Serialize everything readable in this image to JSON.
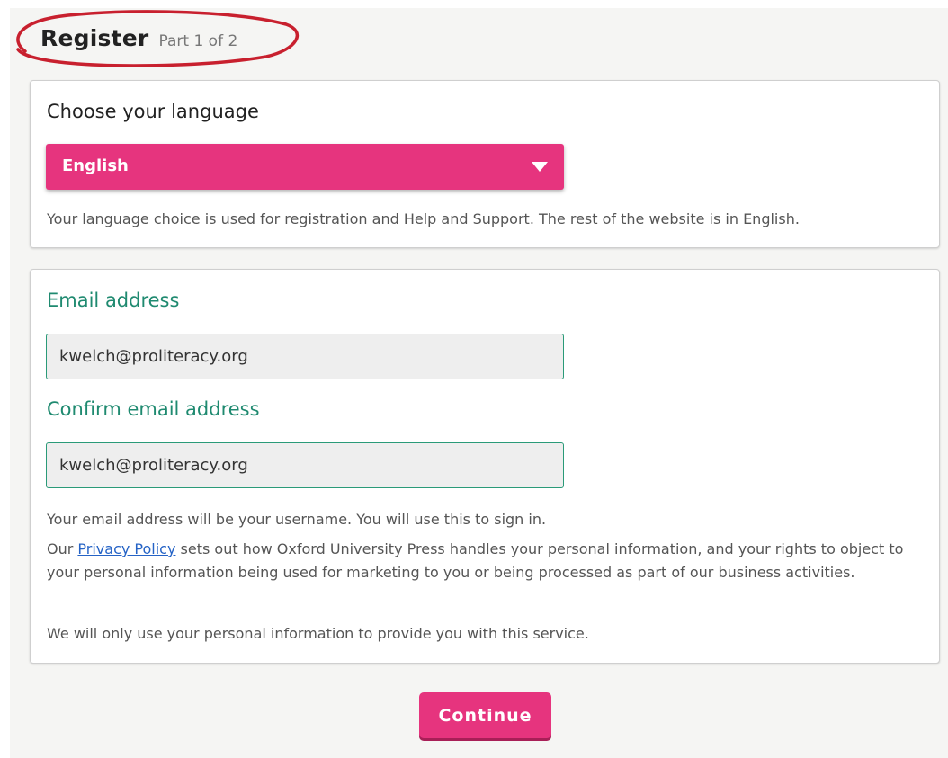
{
  "header": {
    "title": "Register",
    "subtitle": "Part 1 of 2"
  },
  "language": {
    "heading": "Choose your language",
    "selected": "English",
    "note": "Your language choice is used for registration and Help and Support. The rest of the website is in English."
  },
  "email": {
    "label": "Email address",
    "value": "kwelch@proliteracy.org",
    "confirm_label": "Confirm email address",
    "confirm_value": "kwelch@proliteracy.org",
    "username_note": "Your email address will be your username. You will use this to sign in.",
    "privacy_prefix": "Our ",
    "privacy_link": "Privacy Policy",
    "privacy_rest": " sets out how Oxford University Press handles your personal information, and your rights to object to your personal information being used for marketing to you or being processed as part of our business activities.",
    "service_note": "We will only use your personal information to provide you with this service."
  },
  "actions": {
    "continue_label": "Continue"
  },
  "colors": {
    "accent_pink": "#e6347e",
    "label_green": "#1f8a70",
    "annotation_red": "#c8202e"
  },
  "icons": {
    "dropdown": "triangle-down-icon"
  }
}
